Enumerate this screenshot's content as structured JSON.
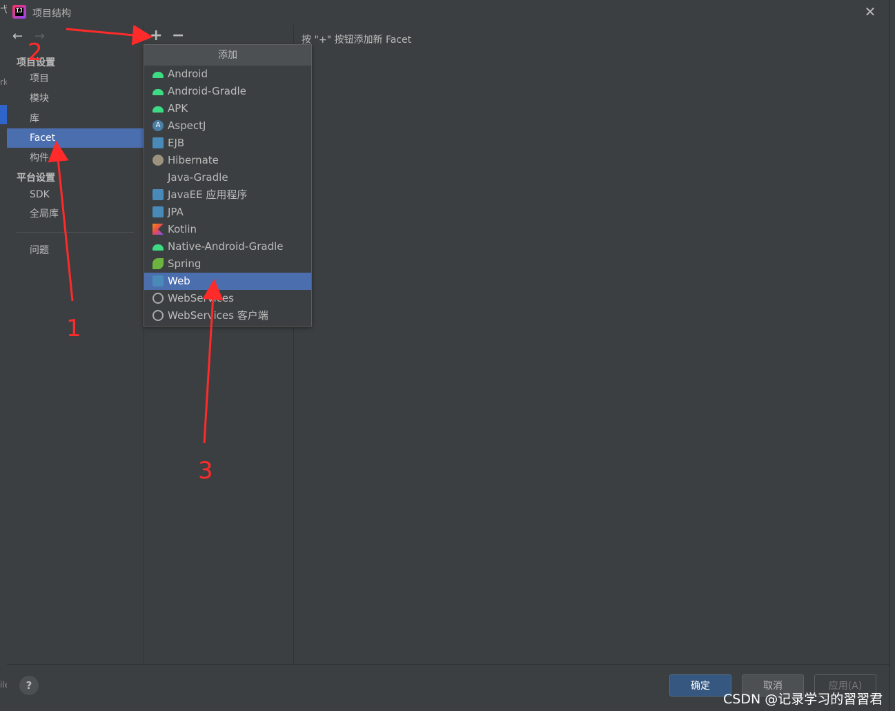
{
  "window": {
    "title": "项目结构",
    "close_icon": "close-icon"
  },
  "background": {
    "left_cut_text": "弋",
    "left_cut_text2": "rk",
    "left_cut_text3": "ile"
  },
  "sidebar": {
    "back_icon": "←",
    "forward_icon": "→",
    "project_settings_header": "项目设置",
    "project_items": [
      "项目",
      "模块",
      "库",
      "Facet",
      "构件"
    ],
    "selected_item": "Facet",
    "platform_settings_header": "平台设置",
    "platform_items": [
      "SDK",
      "全局库"
    ],
    "problems": "问题"
  },
  "toolbar": {
    "add": "+",
    "remove": "−"
  },
  "main": {
    "hint": "按 \"+\" 按钮添加新 Facet"
  },
  "popup": {
    "title": "添加",
    "items": [
      {
        "label": "Android",
        "icon": "android-icon"
      },
      {
        "label": "Android-Gradle",
        "icon": "android-icon"
      },
      {
        "label": "APK",
        "icon": "android-icon"
      },
      {
        "label": "AspectJ",
        "icon": "aspectj-icon",
        "glyph": "A"
      },
      {
        "label": "EJB",
        "icon": "ejb-icon"
      },
      {
        "label": "Hibernate",
        "icon": "hibernate-icon"
      },
      {
        "label": "Java-Gradle",
        "icon": ""
      },
      {
        "label": "JavaEE 应用程序",
        "icon": "javaee-icon"
      },
      {
        "label": "JPA",
        "icon": "jpa-icon"
      },
      {
        "label": "Kotlin",
        "icon": "kotlin-icon"
      },
      {
        "label": "Native-Android-Gradle",
        "icon": "android-icon"
      },
      {
        "label": "Spring",
        "icon": "spring-icon"
      },
      {
        "label": "Web",
        "icon": "web-icon"
      },
      {
        "label": "WebServices",
        "icon": "globe-icon"
      },
      {
        "label": "WebServices 客户端",
        "icon": "globe-icon"
      }
    ],
    "selected": "Web"
  },
  "footer": {
    "help": "?",
    "ok": "确定",
    "cancel": "取消",
    "apply": "应用(A)"
  },
  "annotations": {
    "arrow_color": "#ff2a2a",
    "labels": [
      "1",
      "2",
      "3"
    ]
  },
  "watermark": "CSDN @记录学习的習習君"
}
